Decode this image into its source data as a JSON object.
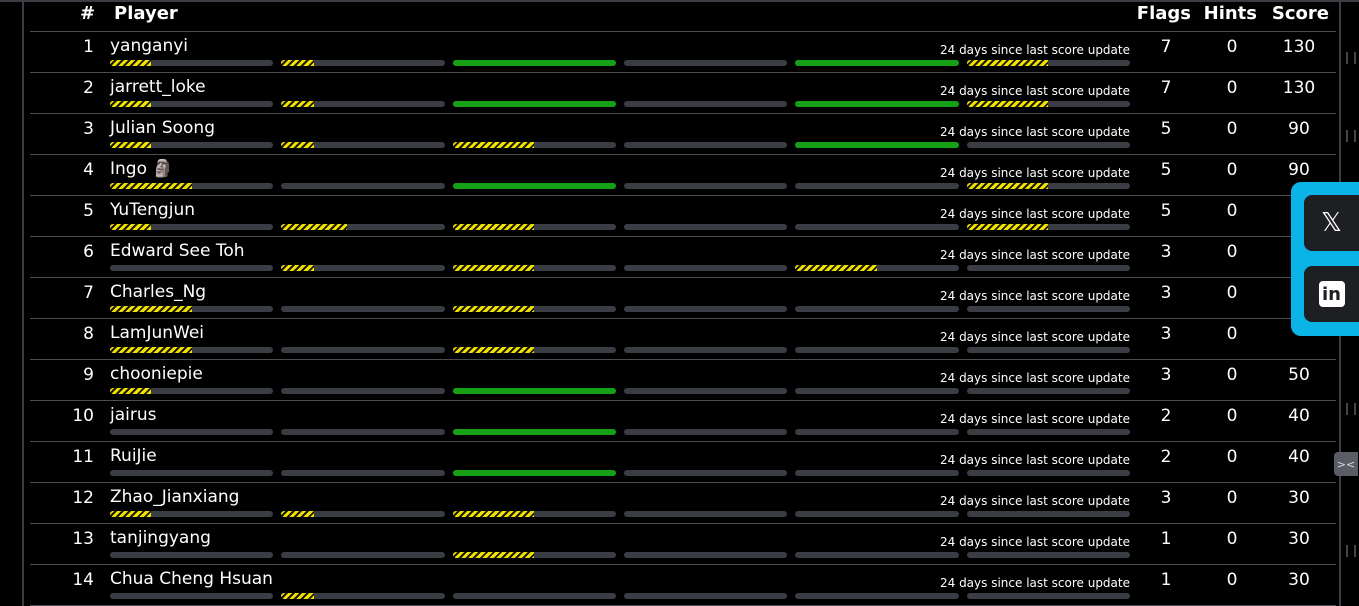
{
  "header": {
    "rank": "#",
    "player": "Player",
    "flags": "Flags",
    "hints": "Hints",
    "score": "Score"
  },
  "rows": [
    {
      "rank": "1",
      "name": "yanganyi",
      "since": "24 days since last score update",
      "flags": "7",
      "hints": "0",
      "score": "130",
      "progress": [
        0.25,
        0.2,
        1,
        0,
        1,
        0.5
      ]
    },
    {
      "rank": "2",
      "name": "jarrett_loke",
      "since": "24 days since last score update",
      "flags": "7",
      "hints": "0",
      "score": "130",
      "progress": [
        0.25,
        0.2,
        1,
        0,
        1,
        0.5
      ]
    },
    {
      "rank": "3",
      "name": "Julian Soong",
      "since": "24 days since last score update",
      "flags": "5",
      "hints": "0",
      "score": "90",
      "progress": [
        0.25,
        0.2,
        0.5,
        0,
        1,
        0
      ]
    },
    {
      "rank": "4",
      "name": "Ingo 🗿",
      "since": "24 days since last score update",
      "flags": "5",
      "hints": "0",
      "score": "90",
      "progress": [
        0.5,
        0,
        1,
        0,
        0,
        0.5
      ]
    },
    {
      "rank": "5",
      "name": "YuTengjun",
      "since": "24 days since last score update",
      "flags": "5",
      "hints": "0",
      "score": "",
      "progress": [
        0.25,
        0.4,
        0.5,
        0,
        0,
        0.5
      ]
    },
    {
      "rank": "6",
      "name": "Edward See Toh",
      "since": "24 days since last score update",
      "flags": "3",
      "hints": "0",
      "score": "",
      "progress": [
        0,
        0.2,
        0.5,
        0,
        0.5,
        0
      ]
    },
    {
      "rank": "7",
      "name": "Charles_Ng",
      "since": "24 days since last score update",
      "flags": "3",
      "hints": "0",
      "score": "",
      "progress": [
        0.5,
        0,
        0.5,
        0,
        0,
        0
      ]
    },
    {
      "rank": "8",
      "name": "LamJunWei",
      "since": "24 days since last score update",
      "flags": "3",
      "hints": "0",
      "score": "",
      "progress": [
        0.5,
        0,
        0.5,
        0,
        0,
        0
      ]
    },
    {
      "rank": "9",
      "name": "chooniepie",
      "since": "24 days since last score update",
      "flags": "3",
      "hints": "0",
      "score": "50",
      "progress": [
        0.25,
        0,
        1,
        0,
        0,
        0
      ]
    },
    {
      "rank": "10",
      "name": "jairus",
      "since": "24 days since last score update",
      "flags": "2",
      "hints": "0",
      "score": "40",
      "progress": [
        0,
        0,
        1,
        0,
        0,
        0
      ]
    },
    {
      "rank": "11",
      "name": "RuiJie",
      "since": "24 days since last score update",
      "flags": "2",
      "hints": "0",
      "score": "40",
      "progress": [
        0,
        0,
        1,
        0,
        0,
        0
      ]
    },
    {
      "rank": "12",
      "name": "Zhao_Jianxiang",
      "since": "24 days since last score update",
      "flags": "3",
      "hints": "0",
      "score": "30",
      "progress": [
        0.25,
        0.2,
        0.5,
        0,
        0,
        0
      ]
    },
    {
      "rank": "13",
      "name": "tanjingyang",
      "since": "24 days since last score update",
      "flags": "1",
      "hints": "0",
      "score": "30",
      "progress": [
        0,
        0,
        0.5,
        0,
        0,
        0
      ]
    },
    {
      "rank": "14",
      "name": "Chua Cheng Hsuan",
      "since": "24 days since last score update",
      "flags": "1",
      "hints": "0",
      "score": "30",
      "progress": [
        0,
        0.2,
        0,
        0,
        0,
        0
      ]
    }
  ],
  "share": {
    "x_icon": "x-logo-icon",
    "linkedin_icon": "linkedin-icon",
    "x_glyph": "𝕏",
    "linkedin_glyph": "in"
  },
  "colors": {
    "partial": "#f2e200",
    "complete": "#16a016",
    "track": "#3a3e44",
    "share_panel": "#0ab4e6"
  }
}
